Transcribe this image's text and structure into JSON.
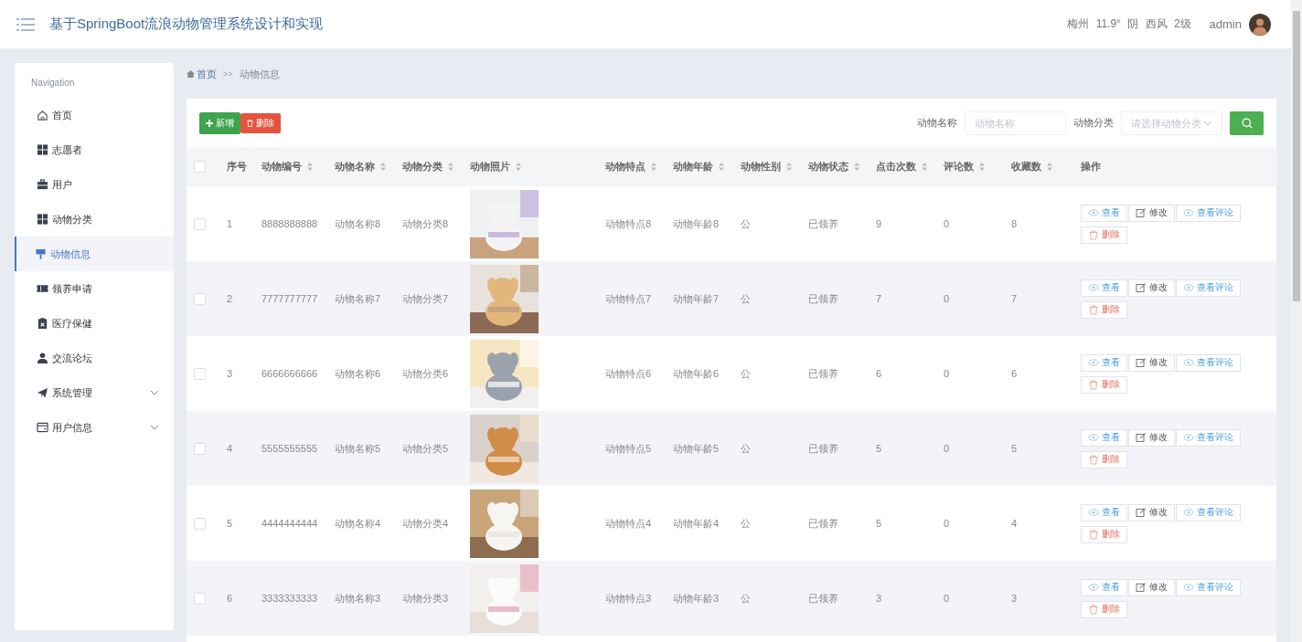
{
  "header": {
    "title": "基于SpringBoot流浪动物管理系统设计和实现",
    "weather": "梅州 11.9° 阴 西风 2级",
    "user": "admin"
  },
  "sidebar": {
    "heading": "Navigation",
    "items": [
      {
        "label": "首页",
        "selected": false,
        "expandable": false
      },
      {
        "label": "志愿者",
        "selected": false,
        "expandable": false
      },
      {
        "label": "用户",
        "selected": false,
        "expandable": false
      },
      {
        "label": "动物分类",
        "selected": false,
        "expandable": false
      },
      {
        "label": "动物信息",
        "selected": true,
        "expandable": false
      },
      {
        "label": "领养申请",
        "selected": false,
        "expandable": false
      },
      {
        "label": "医疗保健",
        "selected": false,
        "expandable": false
      },
      {
        "label": "交流论坛",
        "selected": false,
        "expandable": false
      },
      {
        "label": "系统管理",
        "selected": false,
        "expandable": true
      },
      {
        "label": "用户信息",
        "selected": false,
        "expandable": true
      }
    ]
  },
  "breadcrumb": {
    "home": "首页",
    "separator": ">>",
    "current": "动物信息"
  },
  "toolbar": {
    "add_button": "新增",
    "delete_button": "删除",
    "filters": [
      {
        "label": "动物名称",
        "placeholder": "动物名称",
        "kind": "text"
      },
      {
        "label": "动物分类",
        "placeholder": "请选择动物分类",
        "kind": "select"
      }
    ]
  },
  "table": {
    "select_all": {
      "checked": false
    },
    "columns": [
      {
        "label": "序号",
        "sortable": false
      },
      {
        "label": "动物编号",
        "sortable": true
      },
      {
        "label": "动物名称",
        "sortable": true
      },
      {
        "label": "动物分类",
        "sortable": true
      },
      {
        "label": "动物照片",
        "sortable": true
      },
      {
        "label": "动物特点",
        "sortable": true
      },
      {
        "label": "动物年龄",
        "sortable": true
      },
      {
        "label": "动物性别",
        "sortable": true
      },
      {
        "label": "动物状态",
        "sortable": true
      },
      {
        "label": "点击次数",
        "sortable": true
      },
      {
        "label": "评论数",
        "sortable": true
      },
      {
        "label": "收藏数",
        "sortable": true
      },
      {
        "label": "操作",
        "sortable": false
      }
    ],
    "rows": [
      {
        "checked": false,
        "no": "1",
        "code": "8888888888",
        "name": "动物名称8",
        "category": "动物分类8",
        "trait": "动物特点8",
        "age": "动物年龄8",
        "sex": "公",
        "status": "已领养",
        "clicks": "9",
        "comments": "0",
        "favorites": "8",
        "actions": [
          {
            "label": "查看",
            "kind": "view"
          },
          {
            "label": "修改",
            "kind": "edit"
          },
          {
            "label": "查看评论",
            "kind": "comments"
          },
          {
            "label": "删除",
            "kind": "delete"
          }
        ]
      },
      {
        "checked": false,
        "no": "2",
        "code": "7777777777",
        "name": "动物名称7",
        "category": "动物分类7",
        "trait": "动物特点7",
        "age": "动物年龄7",
        "sex": "公",
        "status": "已领养",
        "clicks": "7",
        "comments": "0",
        "favorites": "7",
        "actions": [
          {
            "label": "查看",
            "kind": "view"
          },
          {
            "label": "修改",
            "kind": "edit"
          },
          {
            "label": "查看评论",
            "kind": "comments"
          },
          {
            "label": "删除",
            "kind": "delete"
          }
        ]
      },
      {
        "checked": false,
        "no": "3",
        "code": "6666666666",
        "name": "动物名称6",
        "category": "动物分类6",
        "trait": "动物特点6",
        "age": "动物年龄6",
        "sex": "公",
        "status": "已领养",
        "clicks": "6",
        "comments": "0",
        "favorites": "6",
        "actions": [
          {
            "label": "查看",
            "kind": "view"
          },
          {
            "label": "修改",
            "kind": "edit"
          },
          {
            "label": "查看评论",
            "kind": "comments"
          },
          {
            "label": "删除",
            "kind": "delete"
          }
        ]
      },
      {
        "checked": false,
        "no": "4",
        "code": "5555555555",
        "name": "动物名称5",
        "category": "动物分类5",
        "trait": "动物特点5",
        "age": "动物年龄5",
        "sex": "公",
        "status": "已领养",
        "clicks": "5",
        "comments": "0",
        "favorites": "5",
        "actions": [
          {
            "label": "查看",
            "kind": "view"
          },
          {
            "label": "修改",
            "kind": "edit"
          },
          {
            "label": "查看评论",
            "kind": "comments"
          },
          {
            "label": "删除",
            "kind": "delete"
          }
        ]
      },
      {
        "checked": false,
        "no": "5",
        "code": "4444444444",
        "name": "动物名称4",
        "category": "动物分类4",
        "trait": "动物特点4",
        "age": "动物年龄4",
        "sex": "公",
        "status": "已领养",
        "clicks": "5",
        "comments": "0",
        "favorites": "4",
        "actions": [
          {
            "label": "查看",
            "kind": "view"
          },
          {
            "label": "修改",
            "kind": "edit"
          },
          {
            "label": "查看评论",
            "kind": "comments"
          },
          {
            "label": "删除",
            "kind": "delete"
          }
        ]
      },
      {
        "checked": false,
        "no": "6",
        "code": "3333333333",
        "name": "动物名称3",
        "category": "动物分类3",
        "trait": "动物特点3",
        "age": "动物年龄3",
        "sex": "公",
        "status": "已领养",
        "clicks": "3",
        "comments": "0",
        "favorites": "3",
        "actions": [
          {
            "label": "查看",
            "kind": "view"
          },
          {
            "label": "修改",
            "kind": "edit"
          },
          {
            "label": "查看评论",
            "kind": "comments"
          },
          {
            "label": "删除",
            "kind": "delete"
          }
        ]
      }
    ]
  }
}
